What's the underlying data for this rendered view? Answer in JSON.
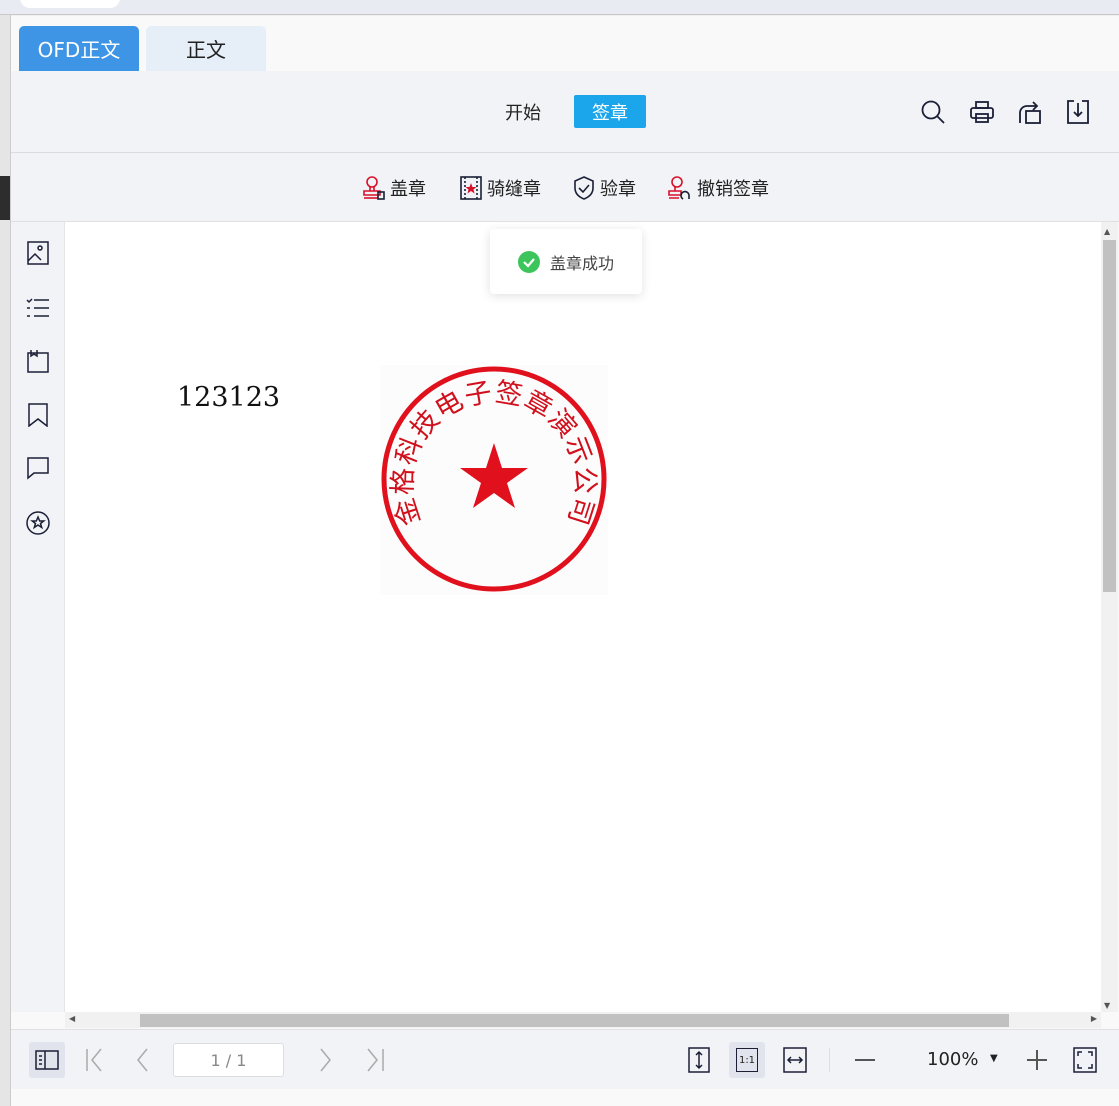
{
  "tabs": [
    {
      "label": "OFD正文",
      "active": true
    },
    {
      "label": "正文",
      "active": false
    }
  ],
  "toolbar": {
    "start_label": "开始",
    "sign_label": "签章",
    "accent": "#1ba5ea"
  },
  "sign_menu": [
    {
      "label": "盖章",
      "icon": "stamp-icon"
    },
    {
      "label": "骑缝章",
      "icon": "cross-page-seal-icon"
    },
    {
      "label": "验章",
      "icon": "shield-check-icon"
    },
    {
      "label": "撤销签章",
      "icon": "undo-stamp-icon"
    }
  ],
  "toast": {
    "message": "盖章成功",
    "icon": "check-circle-icon",
    "color": "#3cc55a"
  },
  "document": {
    "text": "123123",
    "seal_text": "金格科技电子签章演示公司",
    "seal_color": "#e0101c"
  },
  "footer": {
    "page_indicator": "1 / 1",
    "zoom": "100%",
    "actual_size_label": "1:1"
  }
}
